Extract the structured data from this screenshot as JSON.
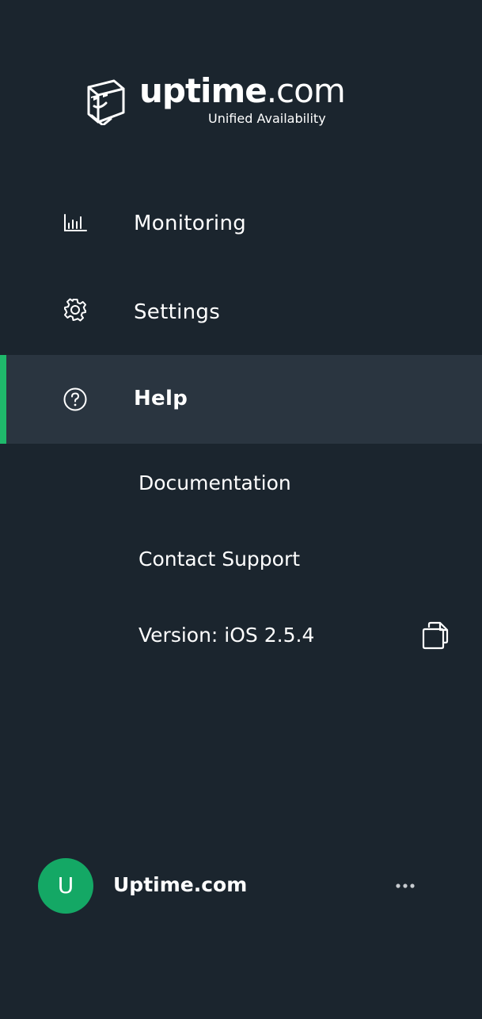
{
  "logo": {
    "word_bold": "uptime",
    "word_light": ".com",
    "tagline": "Unified Availability",
    "icon": "uptime-robot-logo-icon"
  },
  "nav": {
    "items": [
      {
        "label": "Monitoring",
        "icon": "bar-chart-icon",
        "active": false
      },
      {
        "label": "Settings",
        "icon": "gear-icon",
        "active": false
      },
      {
        "label": "Help",
        "icon": "question-circle-icon",
        "active": true
      }
    ],
    "help_subitems": [
      {
        "label": "Documentation"
      },
      {
        "label": "Contact Support"
      },
      {
        "label": "Version: iOS 2.5.4"
      }
    ],
    "copy_icon": "copy-icon"
  },
  "account": {
    "avatar_initial": "U",
    "name": "Uptime.com",
    "more_icon": "more-horizontal-icon"
  },
  "colors": {
    "background": "#1b252e",
    "active_background": "#2a3540",
    "accent": "#1fb96b",
    "avatar": "#14a865",
    "text": "#ffffff"
  }
}
